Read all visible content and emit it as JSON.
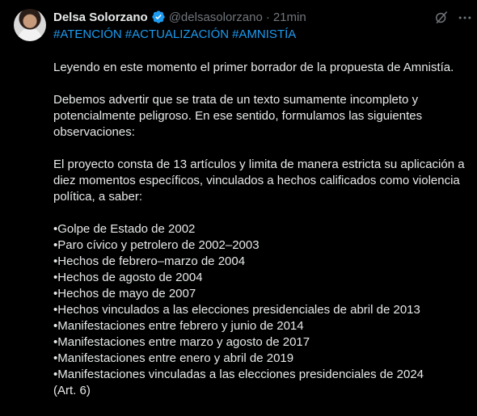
{
  "author": {
    "name": "Delsa Solorzano",
    "handle": "@delsasolorzano",
    "separator": "·",
    "time": "21min"
  },
  "hashtags": [
    "#ATENCIÓN",
    "#ACTUALIZACIÓN",
    "#AMNISTÍA"
  ],
  "paragraphs": [
    "Leyendo en este momento el primer borrador de la propuesta de Amnistía.",
    "Debemos advertir que se trata de un texto sumamente incompleto y potencialmente peligroso. En ese sentido, formulamos las siguientes observaciones:",
    "El proyecto consta de 13 artículos y limita de manera estricta su aplicación a diez momentos específicos, vinculados a hechos calificados como violencia política, a saber:"
  ],
  "bullets": [
    "•Golpe de Estado de 2002",
    "•Paro cívico y petrolero de 2002–2003",
    "•Hechos de febrero–marzo de 2004",
    "•Hechos de agosto de 2004",
    "•Hechos de mayo de 2007",
    "•Hechos vinculados a las elecciones presidenciales de abril de 2013",
    "•Manifestaciones entre febrero y junio de 2014",
    "•Manifestaciones entre marzo y agosto de 2017",
    "•Manifestaciones entre enero y abril de 2019",
    "•Manifestaciones vinculadas a las elecciones presidenciales de 2024",
    "(Art. 6)"
  ],
  "icons": {
    "verified": "verified-badge-icon",
    "grok": "grok-icon",
    "more": "more-icon"
  },
  "colors": {
    "background": "#000000",
    "text": "#e7e9ea",
    "muted": "#71767b",
    "link": "#1d9bf0"
  }
}
